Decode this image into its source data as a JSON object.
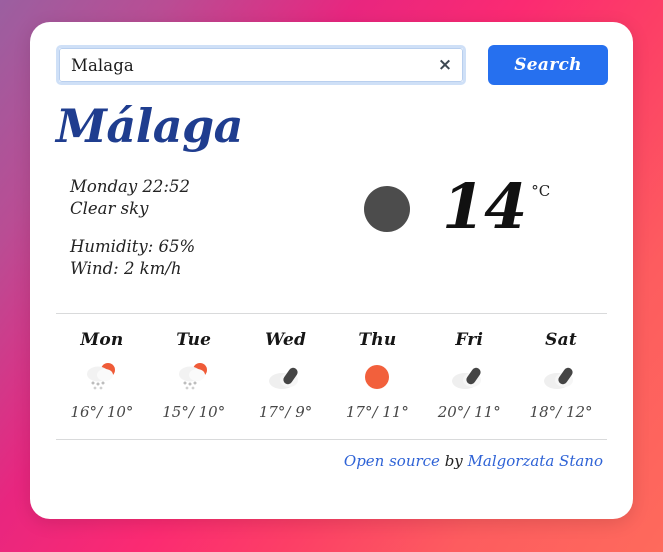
{
  "background": {
    "gradient_from": "#9b5fa0",
    "gradient_mid": "#fb2a72",
    "gradient_to": "#fe6a5c"
  },
  "search": {
    "value": "Malaga",
    "placeholder": "Enter a city...",
    "clear_label": "×",
    "button_label": "Search",
    "button_color": "#2670ef"
  },
  "city": {
    "name": "Málaga",
    "color": "#1f3d8f"
  },
  "current": {
    "day_time": "Monday 22:52",
    "description": "Clear sky",
    "humidity": "Humidity: 65%",
    "wind": "Wind: 2 km/h",
    "icon": "moon-circle-icon",
    "icon_color": "#4c4c4c",
    "temperature": "14",
    "unit": "°C"
  },
  "forecast": [
    {
      "day": "Mon",
      "icon": "sun-rain-cloud-icon",
      "temps": "16°/ 10°"
    },
    {
      "day": "Tue",
      "icon": "sun-rain-cloud-icon",
      "temps": "15°/ 10°"
    },
    {
      "day": "Wed",
      "icon": "cloud-dark-icon",
      "temps": "17°/ 9°"
    },
    {
      "day": "Thu",
      "icon": "sun-icon",
      "temps": "17°/ 11°"
    },
    {
      "day": "Fri",
      "icon": "cloud-dark-icon",
      "temps": "20°/ 11°"
    },
    {
      "day": "Sat",
      "icon": "cloud-dark-icon",
      "temps": "18°/ 12°"
    }
  ],
  "footer": {
    "link1": "Open source",
    "middle": " by ",
    "link2": "Malgorzata Stano",
    "link_color": "#2f63d6"
  }
}
